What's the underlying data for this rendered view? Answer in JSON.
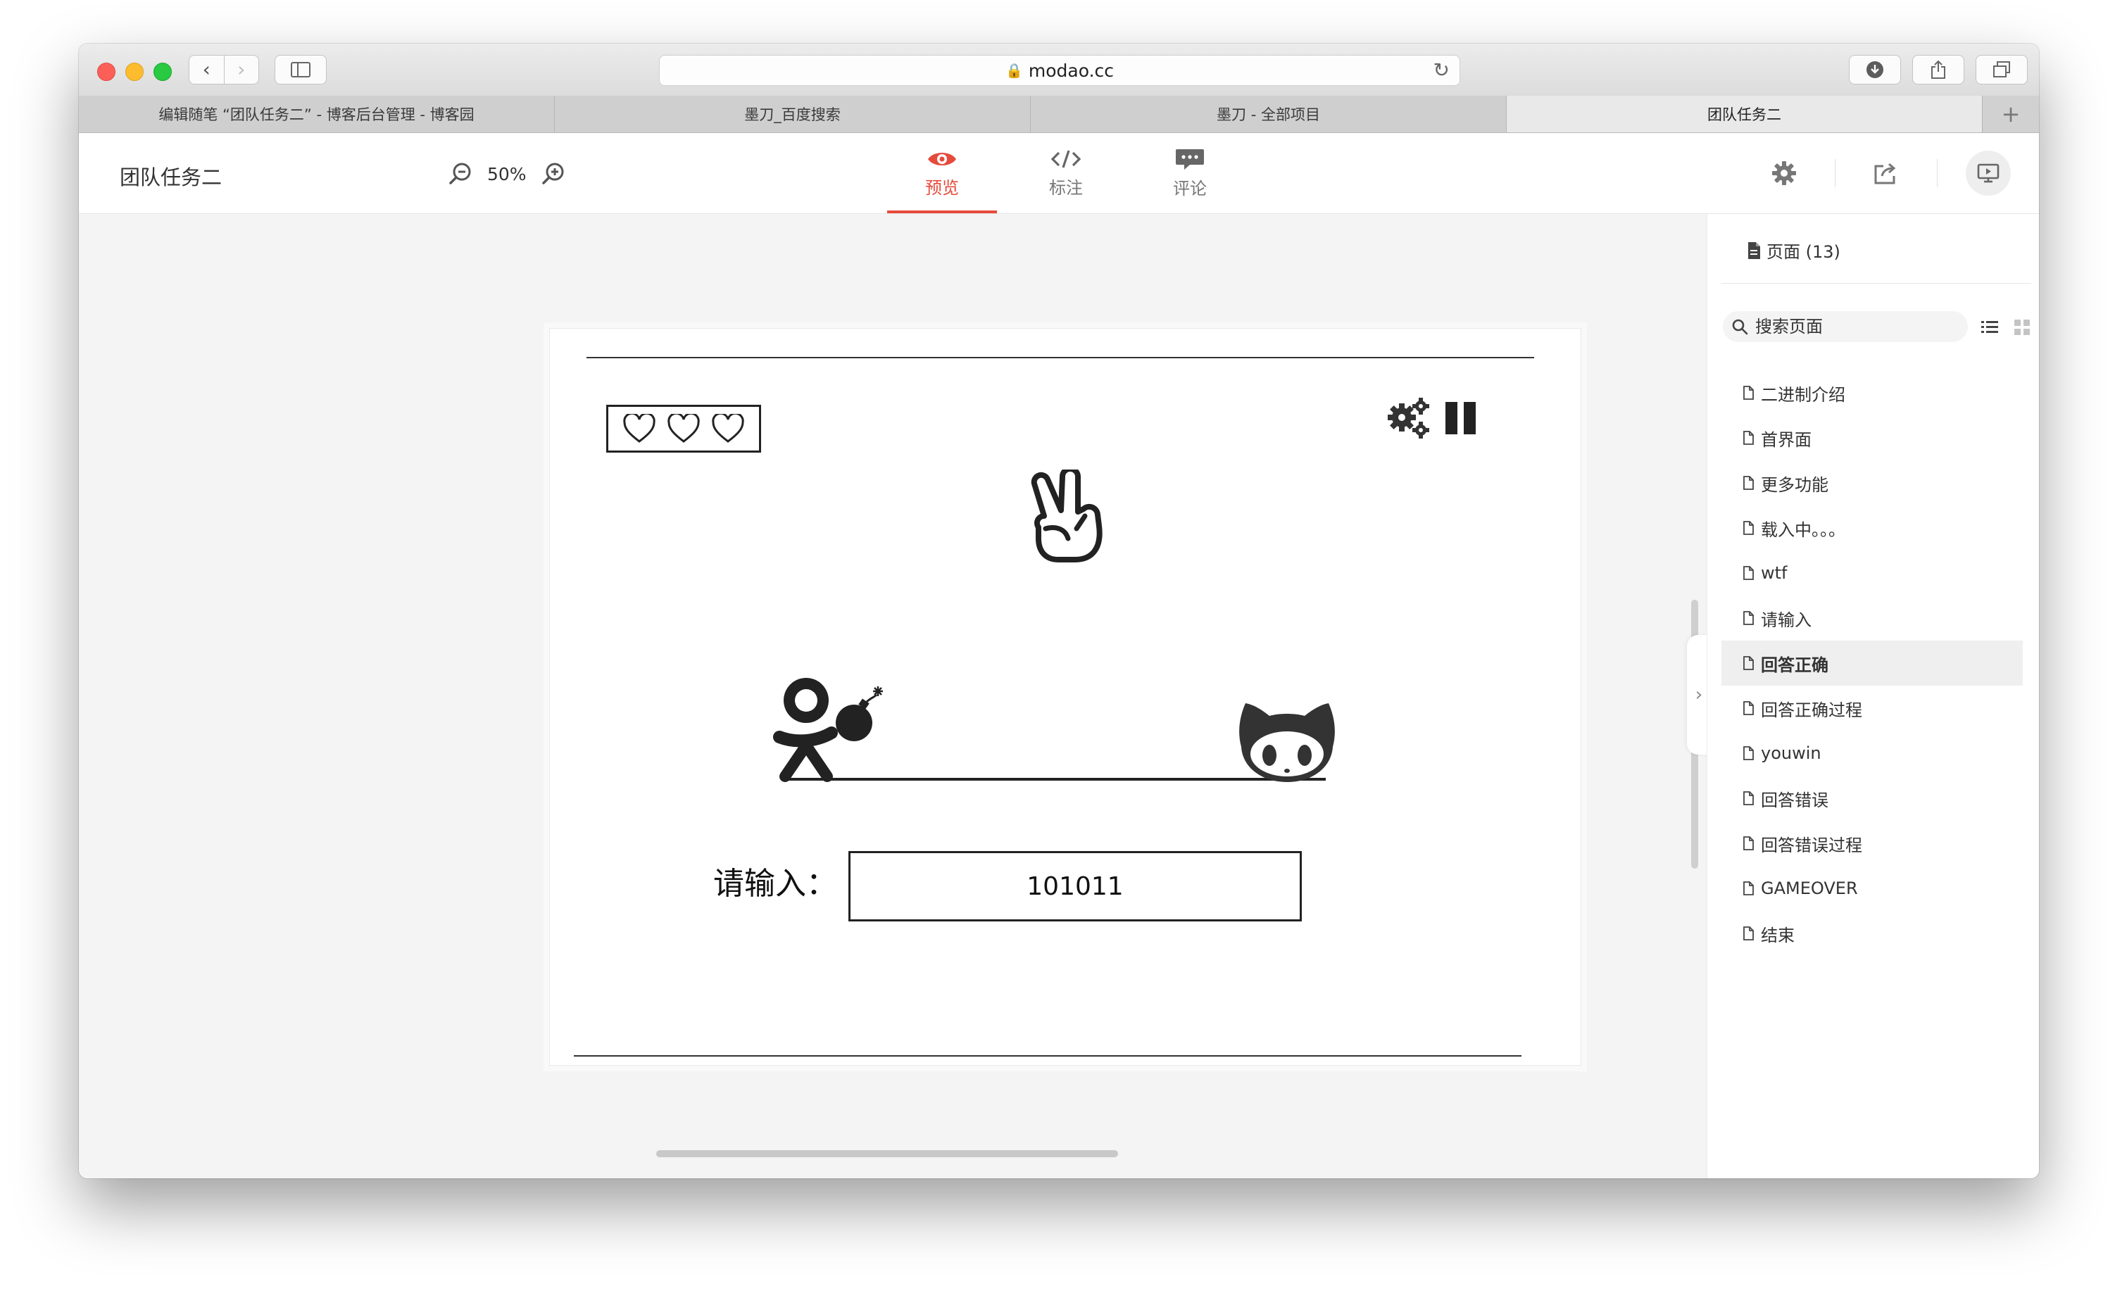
{
  "browser": {
    "url": "modao.cc",
    "tabs": [
      {
        "label": "编辑随笔 “团队任务二” - 博客后台管理 - 博客园",
        "active": false
      },
      {
        "label": "墨刀_百度搜索",
        "active": false
      },
      {
        "label": "墨刀 - 全部项目",
        "active": false
      },
      {
        "label": "团队任务二",
        "active": true
      }
    ],
    "new_tab": "+"
  },
  "header": {
    "project_title": "团队任务二",
    "zoom": "50%",
    "modes": [
      {
        "label": "预览",
        "icon": "eye-icon",
        "active": true
      },
      {
        "label": "标注",
        "icon": "code-icon",
        "active": false
      },
      {
        "label": "评论",
        "icon": "comment-icon",
        "active": false
      }
    ]
  },
  "canvas": {
    "input_label": "请输入：",
    "answer_value": "101011",
    "lives": 3
  },
  "sidebar": {
    "pages_heading": "页面 (13)",
    "search_placeholder": "搜索页面",
    "pages": [
      {
        "label": "二进制介绍",
        "active": false
      },
      {
        "label": "首界面",
        "active": false
      },
      {
        "label": "更多功能",
        "active": false
      },
      {
        "label": "载入中。。。",
        "active": false
      },
      {
        "label": "wtf",
        "active": false
      },
      {
        "label": "请输入",
        "active": false
      },
      {
        "label": "回答正确",
        "active": true
      },
      {
        "label": "回答正确过程",
        "active": false
      },
      {
        "label": "youwin",
        "active": false
      },
      {
        "label": "回答错误",
        "active": false
      },
      {
        "label": "回答错误过程",
        "active": false
      },
      {
        "label": "GAMEOVER",
        "active": false
      },
      {
        "label": "结束",
        "active": false
      }
    ]
  },
  "colors": {
    "accent": "#e64a3b",
    "active_row": "#efefef"
  }
}
